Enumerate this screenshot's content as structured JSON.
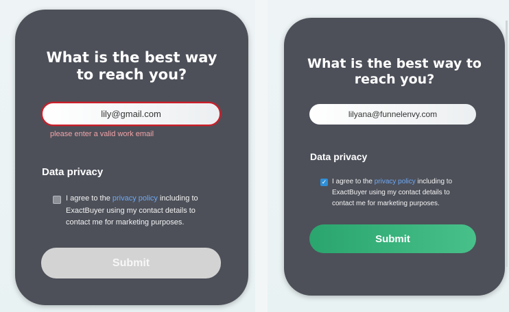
{
  "left_form": {
    "title": "What is the best way to reach you?",
    "email_value": "lily@gmail.com",
    "error_message": "please enter a valid work email",
    "section_title": "Data privacy",
    "consent_prefix": "I agree to the ",
    "consent_link": "privacy policy",
    "consent_suffix": " including to ExactBuyer using my contact details to contact me for marketing purposes.",
    "checkbox_checked": false,
    "submit_label": "Submit",
    "submit_state": "disabled"
  },
  "right_form": {
    "title": "What is the best way to reach you?",
    "email_value": "lilyana@funnelenvy.com",
    "section_title": "Data privacy",
    "consent_prefix": "I agree to the ",
    "consent_link": "privacy policy",
    "consent_suffix": " including to ExactBuyer using my contact details to contact me for marketing purposes.",
    "checkbox_checked": true,
    "checkmark_glyph": "✓",
    "submit_label": "Submit",
    "submit_state": "enabled"
  },
  "colors": {
    "card_bg": "#4d5059",
    "error_border": "#cc1f2a",
    "error_text": "#f2a3a8",
    "link": "#6ea8f5",
    "submit_disabled": "#d3d3d3",
    "submit_enabled": "#2aa56d",
    "checkbox_checked": "#2f8fd8"
  }
}
